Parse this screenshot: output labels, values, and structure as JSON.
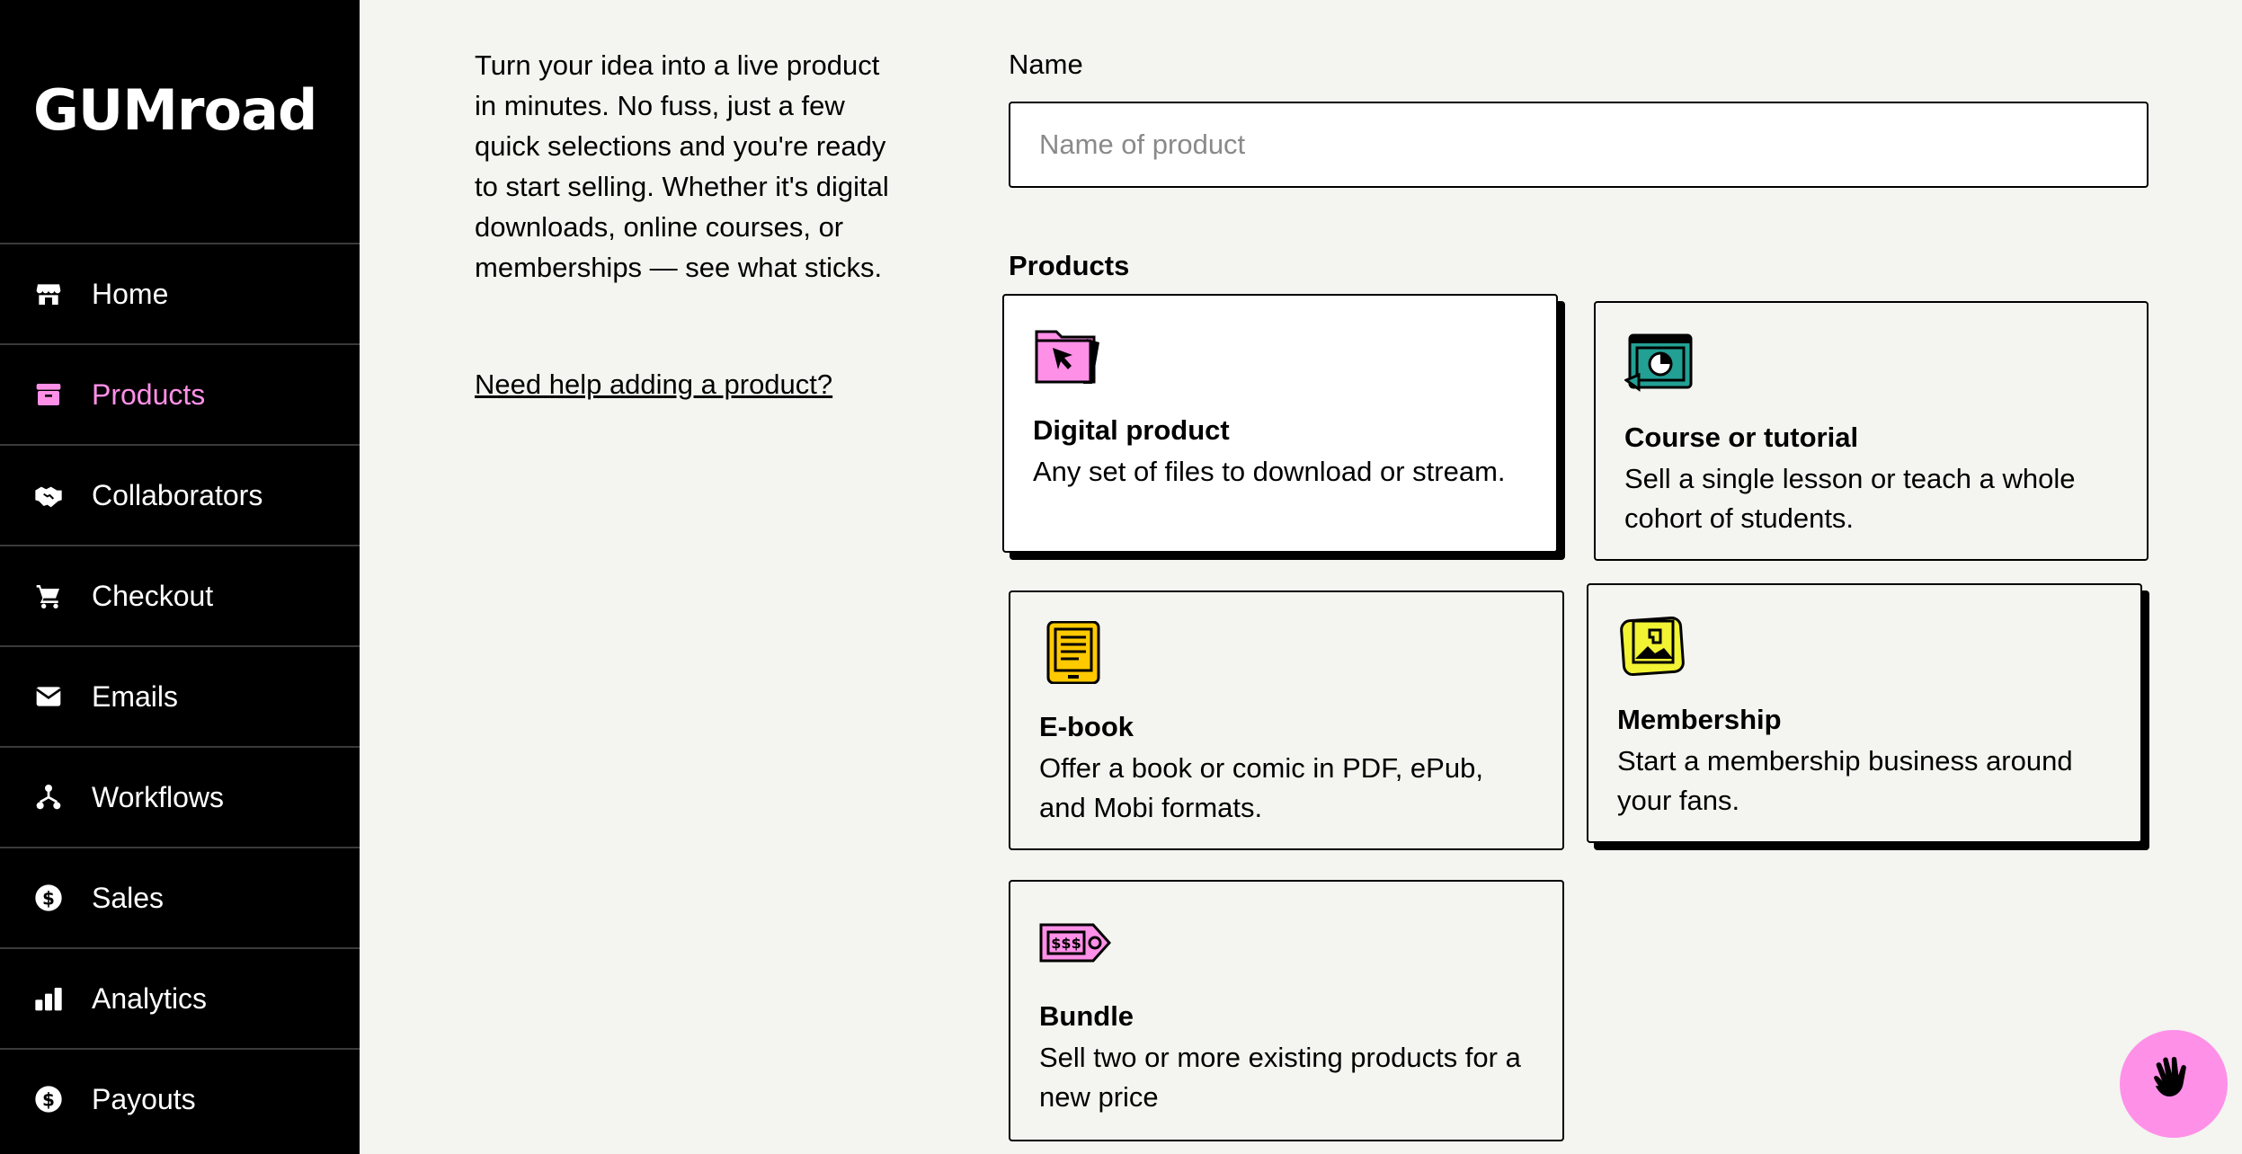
{
  "brand": {
    "logo_text": "GUMroad"
  },
  "sidebar": {
    "items": [
      {
        "label": "Home",
        "icon": "store-icon"
      },
      {
        "label": "Products",
        "icon": "archive-icon",
        "active": true
      },
      {
        "label": "Collaborators",
        "icon": "handshake-icon"
      },
      {
        "label": "Checkout",
        "icon": "cart-icon"
      },
      {
        "label": "Emails",
        "icon": "envelope-icon"
      },
      {
        "label": "Workflows",
        "icon": "workflow-icon"
      },
      {
        "label": "Sales",
        "icon": "dollar-circle-icon"
      },
      {
        "label": "Analytics",
        "icon": "bar-chart-icon"
      },
      {
        "label": "Payouts",
        "icon": "dollar-circle-icon"
      }
    ],
    "active_color": "#ff90e8"
  },
  "intro": {
    "text": "Turn your idea into a live product in minutes. No fuss, just a few quick selections and you're ready to start selling. Whether it's digital downloads, online courses, or memberships — see what sticks.",
    "help_link": "Need help adding a product?"
  },
  "form": {
    "name_label": "Name",
    "name_placeholder": "Name of product",
    "name_value": "",
    "products_label": "Products"
  },
  "product_types": [
    {
      "title": "Digital product",
      "description": "Any set of files to download or stream.",
      "icon": "folder-cursor-icon",
      "selected": true
    },
    {
      "title": "Course or tutorial",
      "description": "Sell a single lesson or teach a whole cohort of students.",
      "icon": "presentation-board-icon"
    },
    {
      "title": "E-book",
      "description": "Offer a book or comic in PDF, ePub, and Mobi formats.",
      "icon": "ereader-icon"
    },
    {
      "title": "Membership",
      "description": "Start a membership business around your fans.",
      "icon": "membership-card-icon"
    },
    {
      "title": "Bundle",
      "description": "Sell two or more existing products for a new price",
      "icon": "price-tag-icon"
    }
  ],
  "colors": {
    "pink": "#ff90e8",
    "teal": "#23a094",
    "yellow": "#ffc900",
    "lime": "#f1f333",
    "background": "#f4f4f0"
  },
  "help_button": {
    "icon": "hand-wave-icon"
  }
}
